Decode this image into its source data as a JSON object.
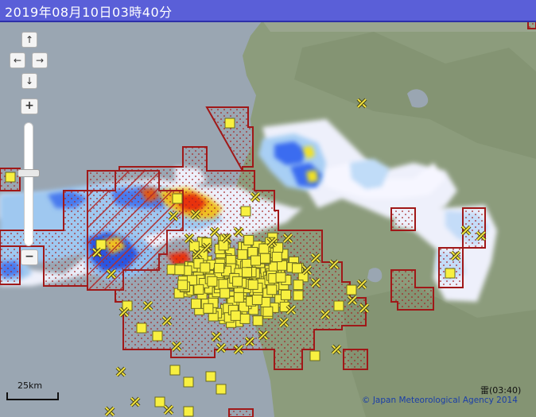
{
  "header": {
    "timestamp": "2019年08月10日03時40分"
  },
  "controls": {
    "pan_up": "↑",
    "pan_left": "←",
    "pan_right": "→",
    "pan_down": "↓",
    "zoom_in": "+",
    "zoom_out": "−"
  },
  "scale": {
    "label": "25km"
  },
  "footer": {
    "credit": "© Japan Meteorological Agency 2014",
    "thunder_label": "雷(03:40)"
  },
  "colors": {
    "title_bar": "#5a5fd8",
    "sea": "#9aa6b2",
    "land": "#8c9c7c",
    "warning_outline": "#a01818",
    "lightning_marker": "#f8f040",
    "rain_light": "#f2f2ff",
    "rain_moderate": "#a0d2ff",
    "rain_heavy": "#2040ff",
    "rain_intense": "#ff2800"
  },
  "legend_icons": {
    "square_marker": "lightning-strike-square",
    "cross_marker": "lightning-strike-cross"
  }
}
